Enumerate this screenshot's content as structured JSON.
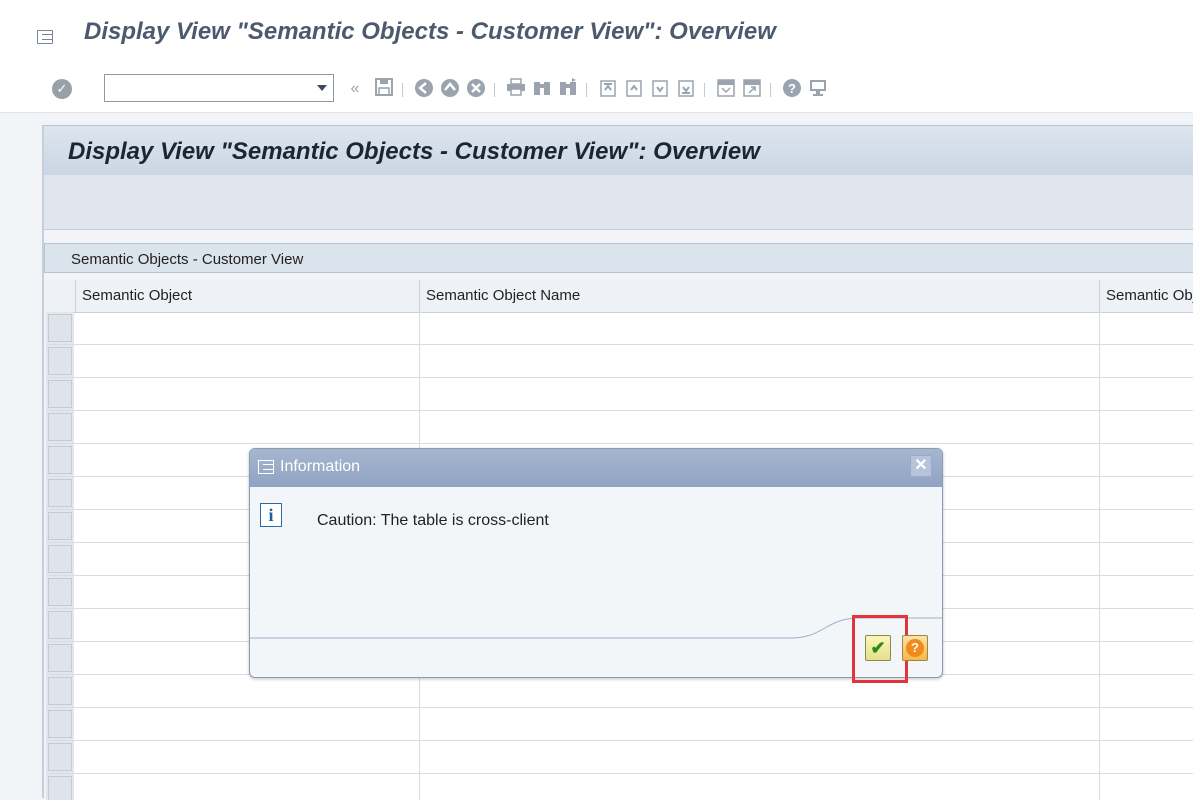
{
  "window": {
    "title": "Display View \"Semantic Objects - Customer View\": Overview"
  },
  "toolbar": {
    "command_field_value": "",
    "icons": [
      "enter-icon",
      "dropdown-icon",
      "back-icon",
      "save-icon",
      "back-green-icon",
      "exit-icon",
      "cancel-icon",
      "print-icon",
      "find-icon",
      "find-next-icon",
      "first-page-icon",
      "previous-page-icon",
      "next-page-icon",
      "last-page-icon",
      "new-session-icon",
      "shortcut-icon",
      "help-icon",
      "customize-layout-icon"
    ]
  },
  "page": {
    "title": "Display View \"Semantic Objects - Customer View\": Overview"
  },
  "table": {
    "caption": "Semantic Objects - Customer View",
    "columns": [
      "Semantic Object",
      "Semantic Object Name",
      "Semantic Object Description"
    ],
    "row_count": 15
  },
  "dialog": {
    "title": "Information",
    "message": "Caution: The table is cross-client",
    "ok_icon": "check-icon",
    "help_icon": "question-icon"
  }
}
